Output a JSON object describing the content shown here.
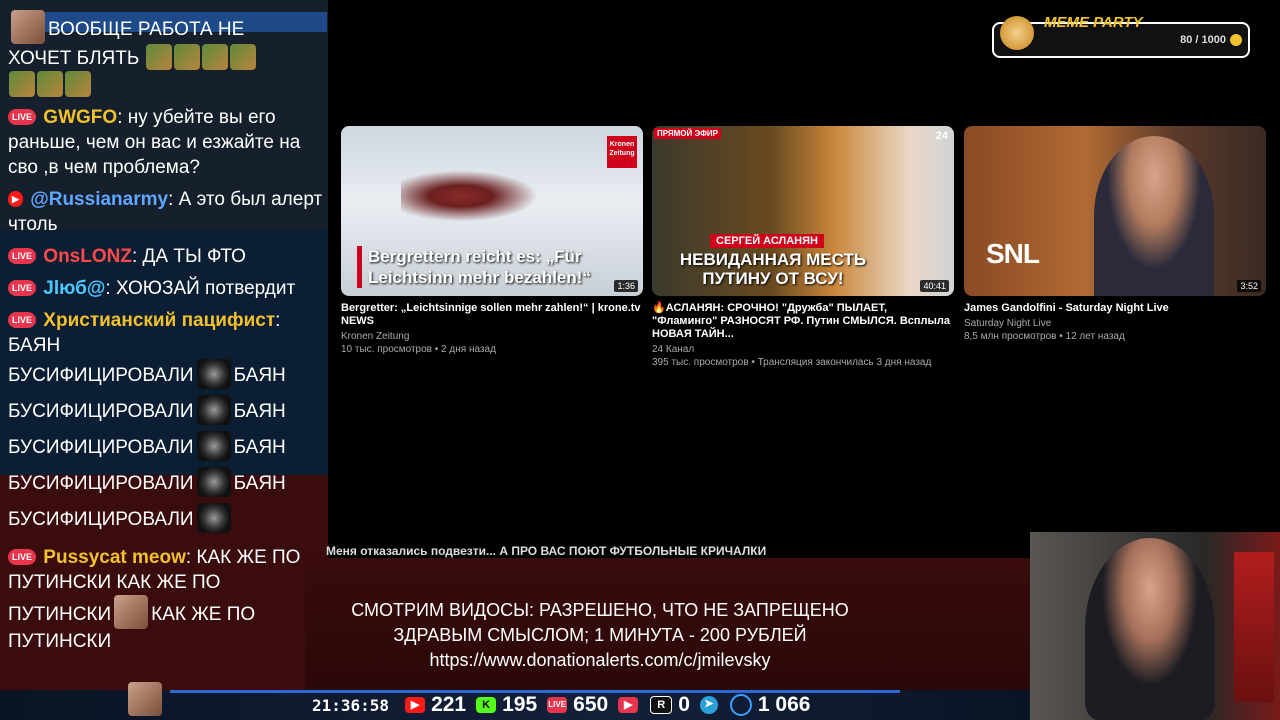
{
  "chat": {
    "m1_text_a": "ВООБЩЕ РАБОТА НЕ",
    "m1_text_b": "ХОЧЕТ БЛЯТЬ",
    "m2_name": "GWGFO",
    "m2_text": ": ну убейте вы его раньше, чем он вас и езжайте на сво ,в чем проблема?",
    "m3_name": "@Russianarmy",
    "m3_text": ": А это был алерт чтоль",
    "m4_name": "OnsLONZ",
    "m4_text": ": ДА ТЫ ФТО",
    "m5_name": "Jlюб@",
    "m5_text": ": ХОЮЗАЙ потвердит",
    "m6_name": "Христианский пацифист",
    "m6_text": ": БАЯН",
    "spam_a": "БУСИФИЦИРОВАЛИ",
    "spam_b": "БАЯН",
    "m7_name": "Pussycat meow",
    "m7_text_a": ": КАК ЖЕ ПО ПУТИНСКИ КАК ЖЕ ПО",
    "m7_text_b": "ПУТИНСКИ",
    "m7_text_c": "КАК ЖЕ ПО",
    "m7_text_d": "ПУТИНСКИ",
    "live_label": "LIVE",
    "name_colors": {
      "m2": "#f2c12e",
      "m3": "#5ea6ff",
      "m4": "#ff4a4a",
      "m5": "#4ac8ff",
      "m6": "#f2c12e",
      "m7": "#f2c12e"
    }
  },
  "meme_party": {
    "title": "MEME PARTY",
    "count": "80 / 1000"
  },
  "videos": [
    {
      "overlay": "Bergrettern reicht es: „Für Leichtsinn mehr bezahlen!“",
      "logo": "Kronen Zeitung",
      "duration": "1:36",
      "title": "Bergretter: „Leichtsinnige sollen mehr zahlen!“ | krone.tv NEWS",
      "channel": "Kronen Zeitung",
      "meta": "10 тыс. просмотров • 2 дня назад"
    },
    {
      "badge": "ПРЯМОЙ ЭФИР",
      "channel_mark": "24",
      "name_bar": "СЕРГЕЙ АСЛАНЯН",
      "overlay": "НЕВИДАННАЯ МЕСТЬ ПУТИНУ ОТ ВСУ!",
      "duration": "40:41",
      "title": "🔥АСЛАНЯН: СРОЧНО! \"Дружба\" ПЫЛАЕТ, \"Фламинго\" РАЗНОСЯТ РФ. Путин СМЫЛСЯ. Всплыла НОВАЯ ТАЙН...",
      "channel": "24 Канал",
      "meta": "395 тыс. просмотров • Трансляция закончилась 3 дня назад"
    },
    {
      "overlay": "SNL",
      "duration": "3:52",
      "title": "James Gandolfini - Saturday Night Live",
      "channel": "Saturday Night Live",
      "meta": "8,5 млн просмотров • 12 лет назад"
    }
  ],
  "ticker": "Меня отказались подвезти... А ПРО ВАС ПОЮТ ФУТБОЛЬНЫЕ КРИЧАЛКИ",
  "donation": {
    "line1": "СМОТРИМ ВИДОСЫ: РАЗРЕШЕНО, ЧТО НЕ ЗАПРЕЩЕНО",
    "line2": "ЗДРАВЫМ СМЫСЛОМ; 1 МИНУТА - 200 РУБЛЕЙ",
    "line3": "https://www.donationalerts.com/c/jmilevsky"
  },
  "status": {
    "clock": "21:36:58",
    "youtube": "221",
    "kick": "195",
    "vk": "650",
    "play": "",
    "rutube": "0",
    "telegram": "",
    "viewers": "1 066",
    "kick_glyph": "K",
    "vk_glyph": "LIVE",
    "play_glyph": "▶",
    "rutube_glyph": "R"
  }
}
